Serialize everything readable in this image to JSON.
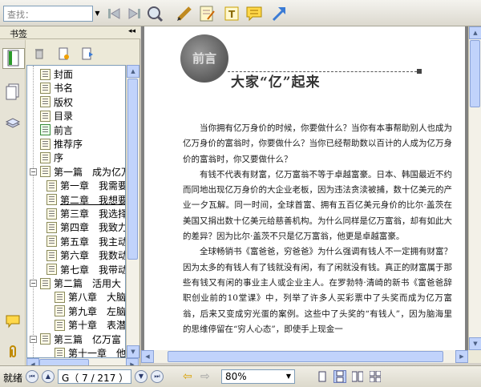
{
  "toolbar": {
    "search_placeholder": "查找："
  },
  "sidebar": {
    "title": "书签",
    "collapse_glyph": "◂◂",
    "tree": [
      {
        "label": "封面",
        "indent": 0,
        "green": false
      },
      {
        "label": "书名",
        "indent": 0,
        "green": false
      },
      {
        "label": "版权",
        "indent": 0,
        "green": false
      },
      {
        "label": "目录",
        "indent": 0,
        "green": false
      },
      {
        "label": "前言",
        "indent": 0,
        "green": true
      },
      {
        "label": "推荐序",
        "indent": 0,
        "green": false
      },
      {
        "label": "序",
        "indent": 0,
        "green": false
      },
      {
        "label": "第一篇　成为亿万",
        "indent": 0,
        "green": false,
        "expander": "−"
      },
      {
        "label": "第一章　我需要",
        "indent": 1,
        "green": false
      },
      {
        "label": "第二章　我想要",
        "indent": 1,
        "green": false,
        "underline": true
      },
      {
        "label": "第三章　我选择",
        "indent": 1,
        "green": false
      },
      {
        "label": "第四章　我致力",
        "indent": 1,
        "green": false
      },
      {
        "label": "第五章　我主动",
        "indent": 1,
        "green": false
      },
      {
        "label": "第六章　我数动",
        "indent": 1,
        "green": false
      },
      {
        "label": "第七章　我带动",
        "indent": 1,
        "green": false
      },
      {
        "label": "第二篇　活用大",
        "indent": 0,
        "green": false,
        "expander": "−"
      },
      {
        "label": "第八章　大脑",
        "indent": 2,
        "green": false
      },
      {
        "label": "第九章　左脑",
        "indent": 2,
        "green": false
      },
      {
        "label": "第十章　表潜",
        "indent": 2,
        "green": false
      },
      {
        "label": "第三篇　亿万富",
        "indent": 0,
        "green": false,
        "expander": "−"
      },
      {
        "label": "第十一章　他",
        "indent": 2,
        "green": false
      }
    ]
  },
  "document": {
    "logo_text": "前言",
    "chapter_title": "大家“亿”起来",
    "paragraphs": [
      "当你拥有亿万身价的时候，你要做什么？当你有本事帮助别人也成为亿万身价的富翁时，你要做什么？当你已经帮助数以百计的人成为亿万身价的富翁时，你又要做什么？",
      "有钱不代表有财富，亿万富翁不等于卓越富豪。日本、韩国最近不约而同地出现亿万身价的大企业老板，因为违法贪渎被捕，数十亿美元的产业一夕瓦解。同一时间，全球首富、拥有五百亿美元身价的比尔·盖茨在美国又捐出数十亿美元给慈善机构。为什么同样是亿万富翁，却有如此大的差异？因为比尔·盖茨不只是亿万富翁，他更是卓越富豪。",
      "全球畅销书《富爸爸，穷爸爸》为什么强调有钱人不一定拥有财富？因为太多的有钱人有了钱就没有闲，有了闲就没有钱。真正的财富属于那些有钱又有闲的事业主人或企业主人。在罗勃特·清崎的新书《富爸爸辞职创业前的10堂课》中，列举了许多人买彩票中了头奖而成为亿万富翁，后来又变成穷光蛋的案例。这些中了头奖的“有钱人”，因为脑海里的思维停留在“穷人心态”，即使手上现金一"
    ]
  },
  "status": {
    "ready": "就绪",
    "page_display": "G（ 7 / 217 ）",
    "zoom": "80%"
  }
}
